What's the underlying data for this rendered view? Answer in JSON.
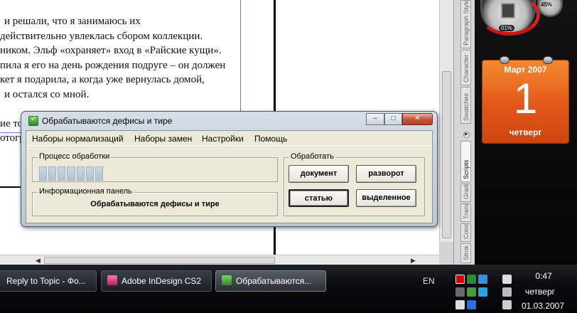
{
  "document": {
    "lines": [
      "и решали, что я занимаюсь их",
      "действительно увлеклась сбором коллекции.",
      "ником. Эльф «охраняет» вход в «Райские кущи».",
      "пила я его на день рождения подруге – он должен",
      "кет я подарила, а когда уже вернулась домой,",
      "и остался со мной.",
      "",
      "ие то",
      "отогр"
    ]
  },
  "side_panel": {
    "tabs": [
      "Paragraph Styles",
      "Character",
      "Swatches",
      "Scripts",
      "Gradi",
      "Trans",
      "Color",
      "Strok"
    ]
  },
  "sidebar": {
    "cpu_gauge": {
      "percent": "01%",
      "mem_percent": "45%"
    },
    "calendar": {
      "month": "Март 2007",
      "day": "1",
      "weekday": "четверг"
    }
  },
  "dialog": {
    "title": "Обрабатываются дефисы и тире",
    "window_buttons": {
      "minimize": "–",
      "maximize": "□",
      "close": "✕"
    },
    "menu": [
      "Наборы нормализаций",
      "Наборы замен",
      "Настройки",
      "Помощь"
    ],
    "progress_group": {
      "label": "Процесс обработки",
      "progress": 0.0
    },
    "info_group": {
      "label": "Информационная панель",
      "text": "Обрабатываются дефисы и тире"
    },
    "process_group": {
      "label": "Обработать",
      "buttons": {
        "document": "документ",
        "spread": "разворот",
        "story": "статью",
        "selection": "выделенное"
      }
    }
  },
  "taskbar": {
    "items": [
      {
        "label": "Reply to Topic - Фо...",
        "active": false
      },
      {
        "label": "Adobe InDesign CS2",
        "active": false
      },
      {
        "label": "Обрабатываются...",
        "active": true
      }
    ],
    "language": "EN",
    "clock": {
      "time": "0:47",
      "weekday": "четверг",
      "date": "01.03.2007"
    }
  }
}
